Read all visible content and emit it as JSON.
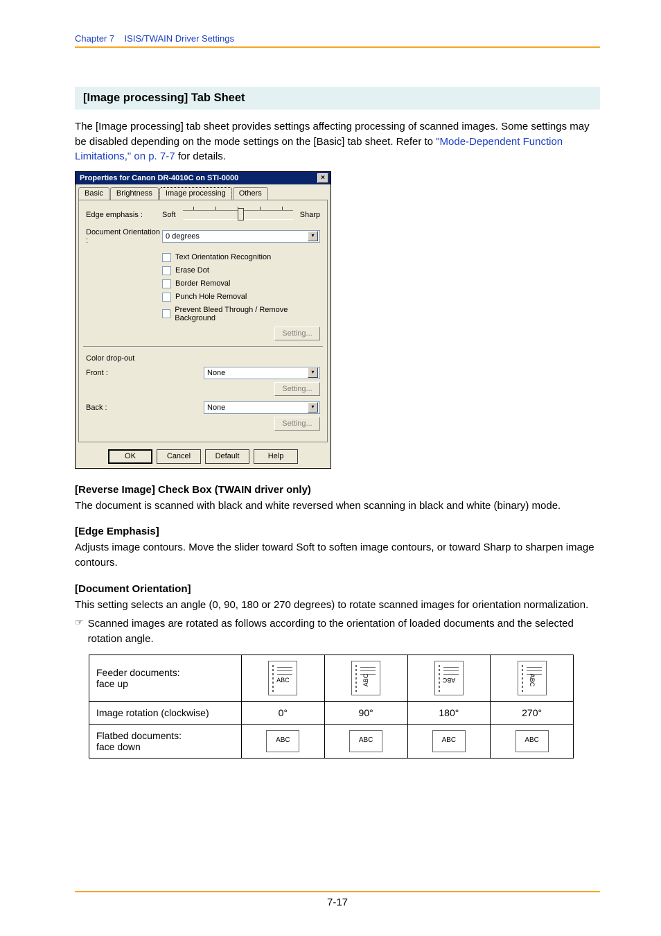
{
  "chapter": {
    "label": "Chapter 7",
    "title": "ISIS/TWAIN Driver Settings"
  },
  "section_heading": "[Image processing] Tab Sheet",
  "intro_para": "The [Image processing] tab sheet provides settings affecting processing of scanned images. Some settings may be disabled depending on the mode settings on the [Basic] tab sheet. Refer to ",
  "intro_link": "\"Mode-Dependent Function Limitations,\" on p. 7-7",
  "intro_tail": " for details.",
  "dialog": {
    "title": "Properties for Canon DR-4010C on STI-0000",
    "tabs": [
      "Basic",
      "Brightness",
      "Image processing",
      "Others"
    ],
    "active_tab_index": 2,
    "edge_emphasis_label": "Edge emphasis :",
    "edge_soft": "Soft",
    "edge_sharp": "Sharp",
    "doc_orientation_label": "Document Orientation :",
    "doc_orientation_value": "0 degrees",
    "cb_text_orientation": "Text Orientation Recognition",
    "cb_erase_dot": "Erase Dot",
    "cb_border_removal": "Border Removal",
    "cb_punch_hole": "Punch Hole Removal",
    "cb_bleed": "Prevent Bleed Through / Remove Background",
    "setting_btn": "Setting...",
    "color_dropout_heading": "Color drop-out",
    "front_label": "Front :",
    "back_label": "Back :",
    "dd_none": "None",
    "buttons": {
      "ok": "OK",
      "cancel": "Cancel",
      "default": "Default",
      "help": "Help"
    }
  },
  "sections": {
    "reverse_image": {
      "title": "[Reverse Image] Check Box (TWAIN driver only)",
      "body": "The document is scanned with black and white reversed when scanning in black and white (binary) mode."
    },
    "edge_emphasis": {
      "title": "[Edge Emphasis]",
      "body": "Adjusts image contours. Move the slider toward Soft to soften image contours, or toward Sharp to sharpen image contours."
    },
    "doc_orientation": {
      "title": "[Document Orientation]",
      "body": "This setting selects an angle (0, 90, 180 or 270 degrees) to rotate scanned images for orientation normalization.",
      "note": "Scanned images are rotated as follows according to the orientation of loaded documents and the selected rotation angle."
    }
  },
  "table": {
    "row1_label": "Feeder documents:\nface up",
    "abc": "ABC",
    "row2_label": "Image rotation (clockwise)",
    "angles": [
      "0°",
      "90°",
      "180°",
      "270°"
    ],
    "row3_label": "Flatbed documents:\nface down"
  },
  "page_number": "7-17"
}
